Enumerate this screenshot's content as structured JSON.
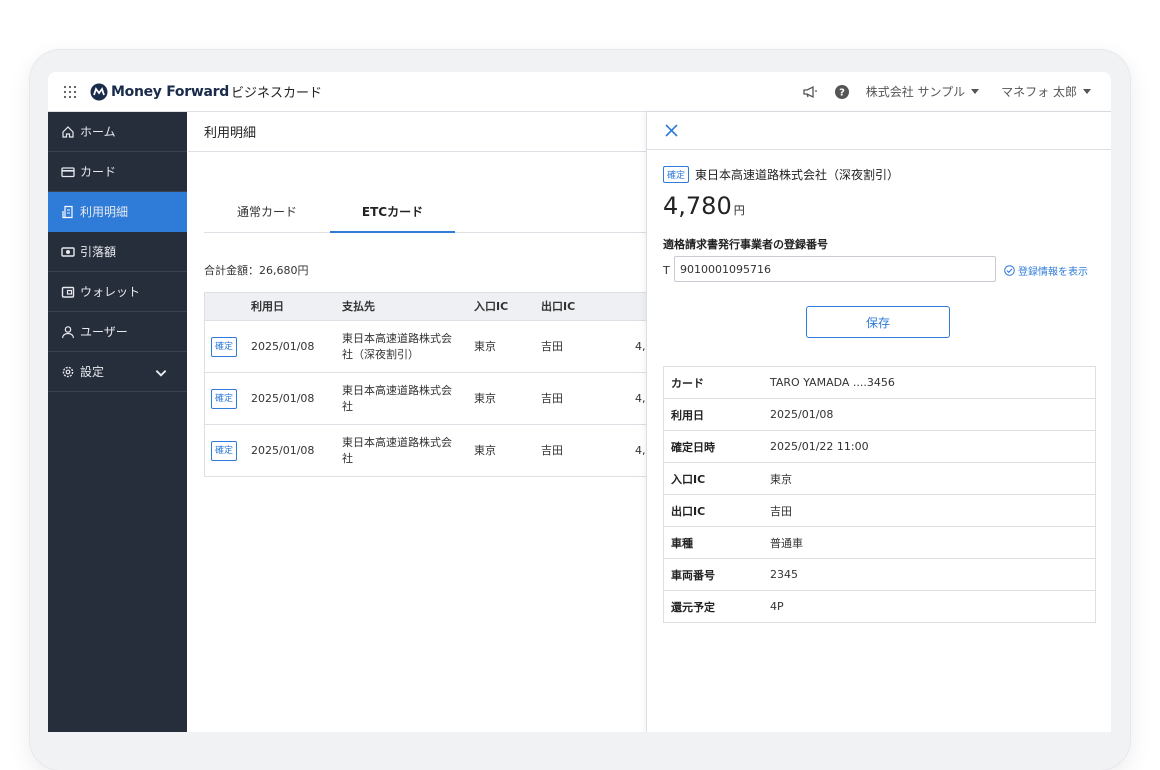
{
  "header": {
    "logo_text": "Money Forward",
    "logo_sub": "ビジネスカード",
    "company": "株式会社 サンプル",
    "user": "マネフォ 太郎"
  },
  "sidebar": {
    "items": [
      {
        "label": "ホーム",
        "icon": "home-icon"
      },
      {
        "label": "カード",
        "icon": "card-icon"
      },
      {
        "label": "利用明細",
        "icon": "statement-icon",
        "active": true
      },
      {
        "label": "引落額",
        "icon": "money-icon"
      },
      {
        "label": "ウォレット",
        "icon": "wallet-icon"
      },
      {
        "label": "ユーザー",
        "icon": "user-icon"
      },
      {
        "label": "設定",
        "icon": "gear-icon"
      }
    ]
  },
  "main": {
    "page_title": "利用明細",
    "tabs": [
      {
        "label": "通常カード",
        "active": false
      },
      {
        "label": "ETCカード",
        "active": true
      }
    ],
    "total": "合計金額：26,680円",
    "table": {
      "headers": [
        "利用日",
        "支払先",
        "入口IC",
        "出口IC"
      ],
      "rows": [
        {
          "status": "確定",
          "date": "2025/01/08",
          "payee_line1": "東日本高速道路株式会",
          "payee_line2": "社（深夜割引）",
          "entry": "東京",
          "exit": "吉田",
          "amount_partial": "4,"
        },
        {
          "status": "確定",
          "date": "2025/01/08",
          "payee_line1": "東日本高速道路株式会",
          "payee_line2": "社",
          "entry": "東京",
          "exit": "吉田",
          "amount_partial": "4,"
        },
        {
          "status": "確定",
          "date": "2025/01/08",
          "payee_line1": "東日本高速道路株式会",
          "payee_line2": "社",
          "entry": "東京",
          "exit": "吉田",
          "amount_partial": "4,"
        }
      ]
    }
  },
  "panel": {
    "status": "確定",
    "payee": "東日本高速道路株式会社（深夜割引）",
    "amount": "4,780",
    "unit": "円",
    "reg_label": "適格請求書発行事業者の登録番号",
    "reg_prefix": "T",
    "reg_value": "9010001095716",
    "reg_link": "登録情報を表示",
    "save_label": "保存",
    "details": [
      {
        "key": "カード",
        "value": "TARO YAMADA ....3456"
      },
      {
        "key": "利用日",
        "value": "2025/01/08"
      },
      {
        "key": "確定日時",
        "value": "2025/01/22 11:00"
      },
      {
        "key": "入口IC",
        "value": "東京"
      },
      {
        "key": "出口IC",
        "value": "吉田"
      },
      {
        "key": "車種",
        "value": "普通車"
      },
      {
        "key": "車両番号",
        "value": "2345"
      },
      {
        "key": "還元予定",
        "value": "4P"
      }
    ]
  },
  "colors": {
    "accent": "#2f7bd8",
    "sidebar": "#262d3b",
    "border": "#dcdfe3"
  }
}
